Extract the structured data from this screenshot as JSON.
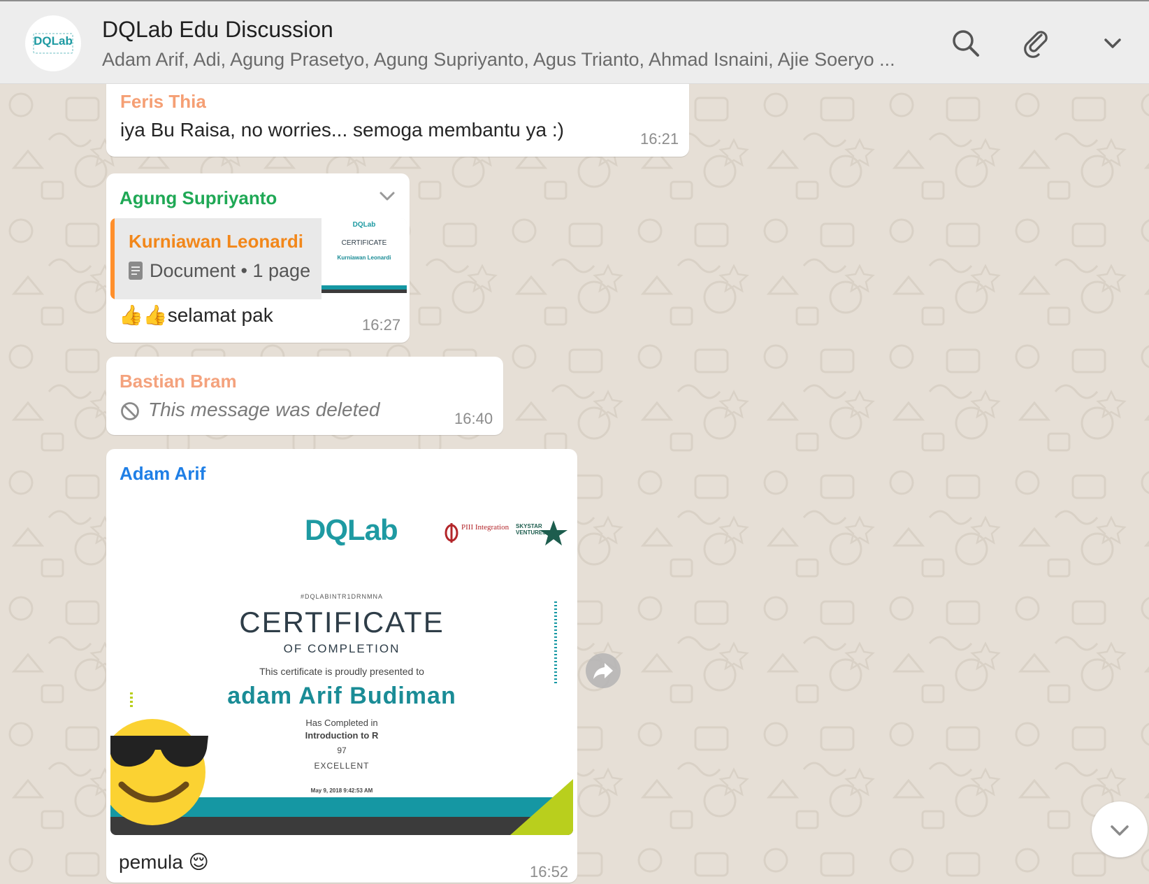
{
  "header": {
    "avatar_text": "DQLab",
    "title": "DQLab Edu Discussion",
    "members": "Adam Arif, Adi, Agung Prasetyo, Agung Supriyanto, Agus Trianto, Ahmad Isnaini, Ajie Soeryo ..."
  },
  "icons": {
    "search": "search-icon",
    "attach": "paperclip-icon",
    "menu": "chevron-down-icon",
    "deleted": "prohibited-icon",
    "forward": "forward-icon",
    "scroll": "chevron-down-icon",
    "document": "document-icon"
  },
  "colors": {
    "feris": "#f59f74",
    "agung": "#1fa855",
    "bastian": "#f4a27d",
    "adam": "#1f7fe6",
    "quote_accent": "#ff8f2c"
  },
  "messages": [
    {
      "sender": "Feris Thia",
      "text": "iya Bu Raisa, no worries... semoga membantu ya :)",
      "time": "16:21"
    },
    {
      "sender": "Agung Supriyanto",
      "quote": {
        "name": "Kurniawan Leonardi",
        "doc": "Document • 1 page",
        "thumb_logo": "DQLab",
        "thumb_title": "CERTIFICATE",
        "thumb_name": "Kurniawan Leonardi"
      },
      "text": "👍👍selamat pak",
      "time": "16:27"
    },
    {
      "sender": "Bastian Bram",
      "text": "This message was deleted",
      "time": "16:40"
    },
    {
      "sender": "Adam Arif",
      "certificate": {
        "logo": "DQLab",
        "partner_1": "PIII Integration",
        "partner_2": "SKYSTAR VENTURES",
        "code": "#DQLABINTR1DRNMNA",
        "title": "CERTIFICATE",
        "subtitle": "OF COMPLETION",
        "presented": "This certificate is proudly presented to",
        "name": "adam Arif Budiman",
        "completed": "Has Completed in",
        "course": "Introduction to R",
        "score": "97",
        "grade": "EXCELLENT",
        "date": "May 9, 2018 9:42:53 AM"
      },
      "text": "pemula 😌",
      "time": "16:52"
    }
  ]
}
